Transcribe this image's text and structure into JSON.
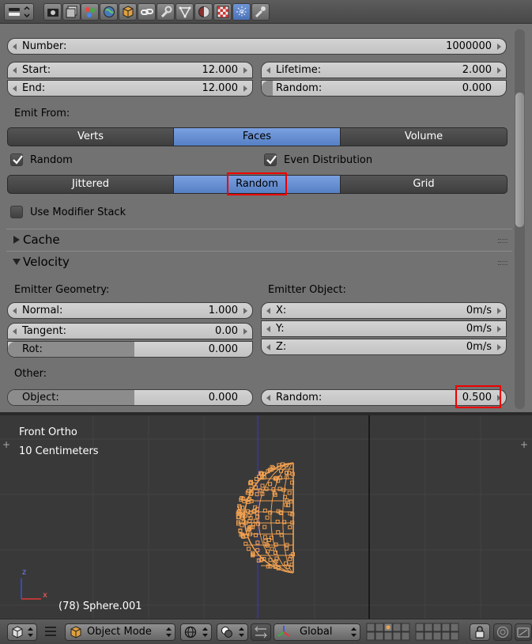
{
  "toolbar": {
    "icons": [
      "editor-type-icon",
      "render-icon",
      "render-layers-icon",
      "scene-icon",
      "world-icon",
      "object-icon",
      "constraints-icon",
      "modifiers-icon",
      "data-icon",
      "material-icon",
      "texture-icon",
      "particles-icon",
      "physics-icon"
    ],
    "active": "particles-icon"
  },
  "emission": {
    "number": {
      "label": "Number:",
      "value": "1000000"
    },
    "start": {
      "label": "Start:",
      "value": "12.000"
    },
    "end": {
      "label": "End:",
      "value": "12.000"
    },
    "lifetime": {
      "label": "Lifetime:",
      "value": "2.000"
    },
    "lifetime_random": {
      "label": "Random:",
      "value": "0.000"
    },
    "emit_from_label": "Emit From:",
    "emit_from_options": [
      "Verts",
      "Faces",
      "Volume"
    ],
    "emit_from_selected": "Faces",
    "random_checkbox": {
      "label": "Random",
      "checked": true
    },
    "even_distribution_checkbox": {
      "label": "Even Distribution",
      "checked": true
    },
    "distribution_options": [
      "Jittered",
      "Random",
      "Grid"
    ],
    "distribution_selected": "Random",
    "use_modifier_stack": {
      "label": "Use Modifier Stack",
      "checked": false
    }
  },
  "panels": {
    "cache": {
      "title": "Cache",
      "expanded": false
    },
    "velocity": {
      "title": "Velocity",
      "expanded": true
    }
  },
  "velocity": {
    "emitter_geometry_label": "Emitter Geometry:",
    "emitter_object_label": "Emitter Object:",
    "normal": {
      "label": "Normal:",
      "value": "1.000"
    },
    "tangent": {
      "label": "Tangent:",
      "value": "0.00"
    },
    "rot": {
      "label": "Rot:",
      "value": "0.000"
    },
    "x": {
      "label": "X:",
      "value": "0m/s"
    },
    "y": {
      "label": "Y:",
      "value": "0m/s"
    },
    "z": {
      "label": "Z:",
      "value": "0m/s"
    },
    "other_label": "Other:",
    "object": {
      "label": "Object:",
      "value": "0.000"
    },
    "random": {
      "label": "Random:",
      "value": "0.500"
    }
  },
  "viewport": {
    "view_name": "Front Ortho",
    "scale": "10 Centimeters",
    "object_info": "(78) Sphere.001",
    "axis_z": "z",
    "axis_x": "x"
  },
  "bottom_bar": {
    "mode": "Object Mode",
    "orientation": "Global"
  },
  "colors": {
    "accent_blue": "#5680c4",
    "highlight_red": "#e00000",
    "mesh_orange": "#f0a050"
  }
}
